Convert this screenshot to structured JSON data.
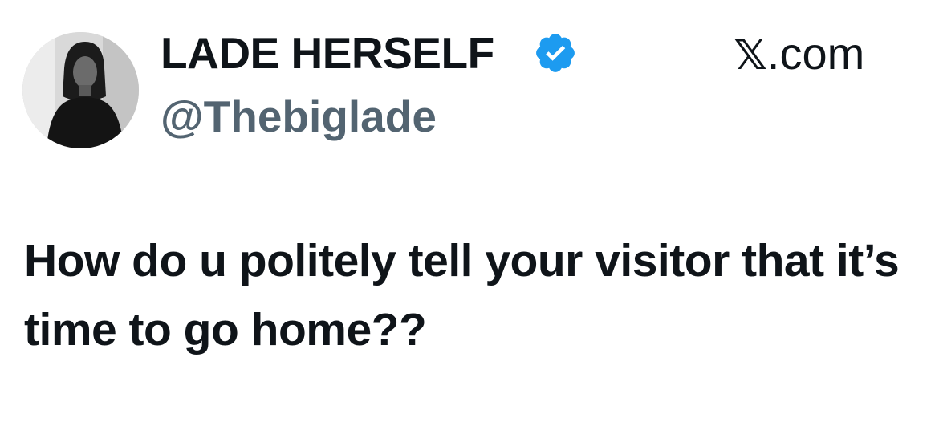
{
  "author": {
    "display_name": "LADE HERSELF",
    "handle": "@Thebiglade",
    "verified": true,
    "avatar_icon": "profile-photo-woman"
  },
  "source": {
    "logo_icon": "x-logo",
    "logo_text": "𝕏",
    "label_suffix": ".com"
  },
  "tweet": {
    "text": "How do u politely tell your visitor that it’s time to go home??"
  },
  "colors": {
    "text_primary": "#0f1419",
    "text_secondary": "#536471",
    "verified_blue": "#1d9bf0",
    "background": "#ffffff"
  }
}
